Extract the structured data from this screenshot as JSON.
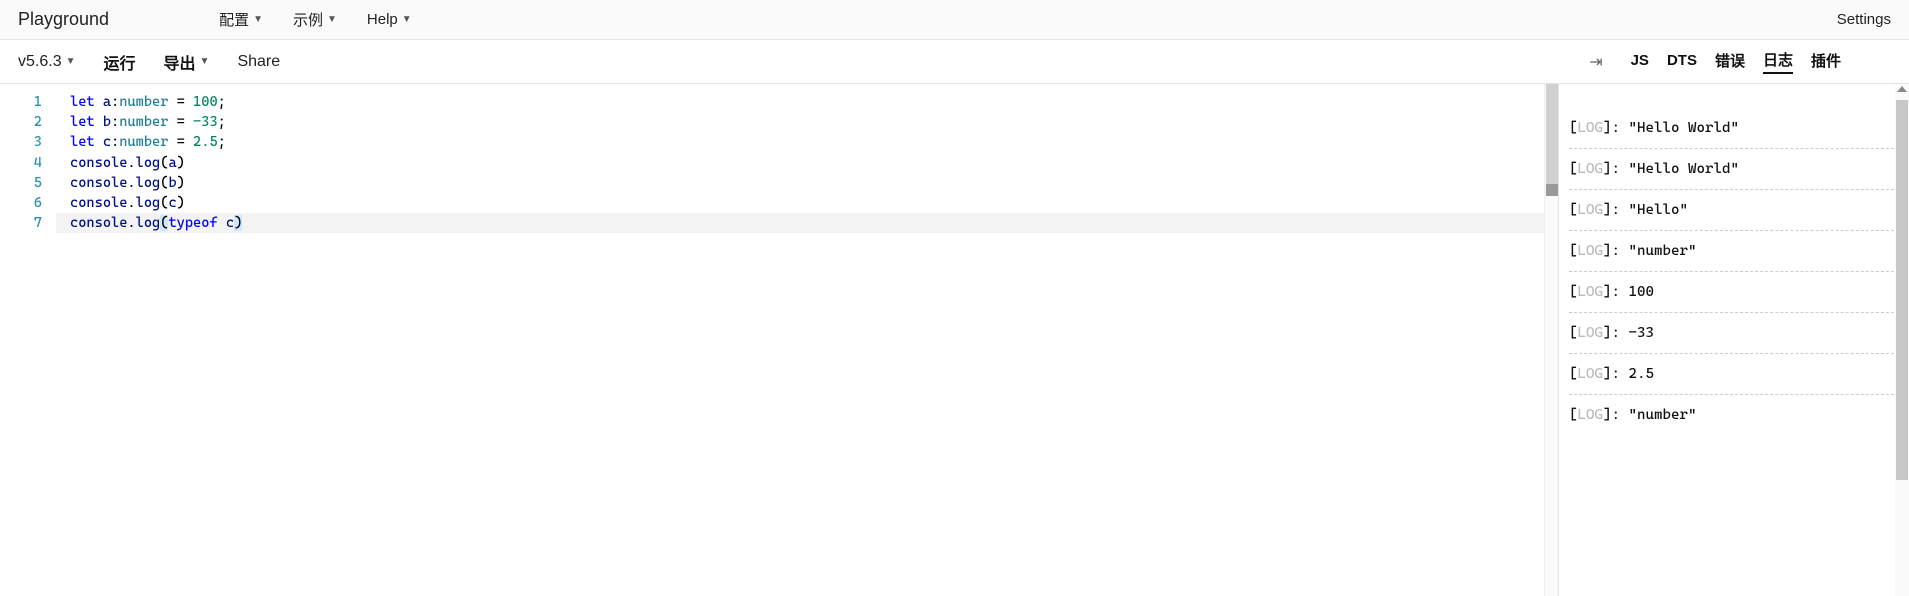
{
  "header": {
    "title": "Playground",
    "menu": {
      "config": "配置",
      "examples": "示例",
      "help": "Help"
    },
    "settings": "Settings"
  },
  "toolbar": {
    "version": "v5.6.3",
    "run": "运行",
    "export": "导出",
    "share": "Share"
  },
  "tabs": {
    "js": "JS",
    "dts": "DTS",
    "errors": "错误",
    "logs": "日志",
    "plugins": "插件",
    "active": "logs"
  },
  "editor": {
    "current_line": 7,
    "lines": [
      {
        "n": 1,
        "tokens": [
          [
            "kw",
            "let"
          ],
          [
            "pn",
            " "
          ],
          [
            "id",
            "a"
          ],
          [
            "pn",
            ":"
          ],
          [
            "type",
            "number"
          ],
          [
            "pn",
            " = "
          ],
          [
            "num",
            "100"
          ],
          [
            "pn",
            ";"
          ]
        ]
      },
      {
        "n": 2,
        "tokens": [
          [
            "kw",
            "let"
          ],
          [
            "pn",
            " "
          ],
          [
            "id",
            "b"
          ],
          [
            "pn",
            ":"
          ],
          [
            "type",
            "number"
          ],
          [
            "pn",
            " = "
          ],
          [
            "num",
            "-33"
          ],
          [
            "pn",
            ";"
          ]
        ]
      },
      {
        "n": 3,
        "tokens": [
          [
            "kw",
            "let"
          ],
          [
            "pn",
            " "
          ],
          [
            "id",
            "c"
          ],
          [
            "pn",
            ":"
          ],
          [
            "type",
            "number"
          ],
          [
            "pn",
            " = "
          ],
          [
            "num",
            "2.5"
          ],
          [
            "pn",
            ";"
          ]
        ]
      },
      {
        "n": 4,
        "tokens": [
          [
            "id",
            "console"
          ],
          [
            "pn",
            "."
          ],
          [
            "id",
            "log"
          ],
          [
            "pn",
            "("
          ],
          [
            "id",
            "a"
          ],
          [
            "pn",
            ")"
          ]
        ]
      },
      {
        "n": 5,
        "tokens": [
          [
            "id",
            "console"
          ],
          [
            "pn",
            "."
          ],
          [
            "id",
            "log"
          ],
          [
            "pn",
            "("
          ],
          [
            "id",
            "b"
          ],
          [
            "pn",
            ")"
          ]
        ]
      },
      {
        "n": 6,
        "tokens": [
          [
            "id",
            "console"
          ],
          [
            "pn",
            "."
          ],
          [
            "id",
            "log"
          ],
          [
            "pn",
            "("
          ],
          [
            "id",
            "c"
          ],
          [
            "pn",
            ")"
          ]
        ]
      },
      {
        "n": 7,
        "tokens": [
          [
            "id",
            "console"
          ],
          [
            "pn",
            "."
          ],
          [
            "id",
            "log"
          ],
          [
            "pn-match",
            "("
          ],
          [
            "kw",
            "typeof"
          ],
          [
            "pn",
            " "
          ],
          [
            "id",
            "c"
          ],
          [
            "pn-match",
            ")"
          ]
        ]
      }
    ]
  },
  "output": {
    "label": "LOG",
    "entries": [
      "\"Hello World\"",
      "\"Hello World\"",
      "\"Hello\"",
      "\"number\"",
      "100",
      "-33",
      "2.5",
      "\"number\""
    ]
  }
}
